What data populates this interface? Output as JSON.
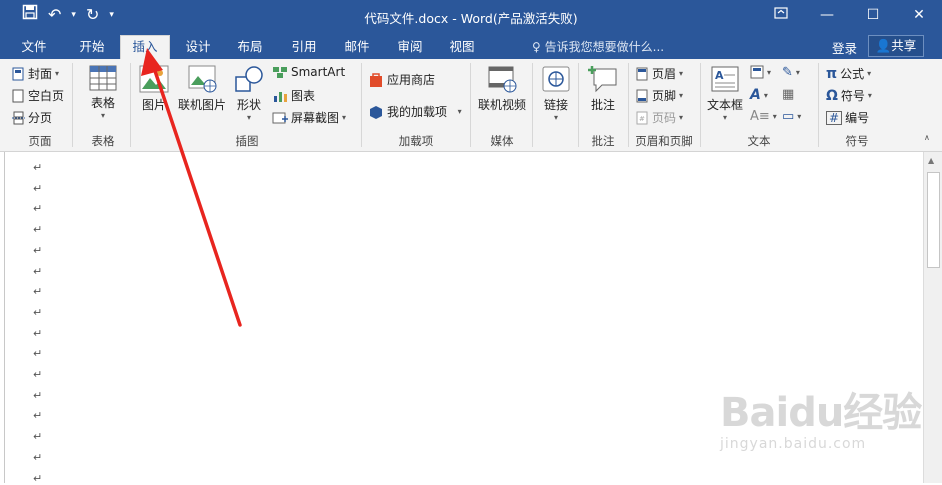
{
  "window": {
    "title": "代码文件.docx - Word(产品激活失败)",
    "controls": [
      "restore-ribbon",
      "minimize",
      "maximize",
      "close"
    ]
  },
  "qat": {
    "save": "save-icon",
    "undo": "undo-icon",
    "redo": "redo-icon"
  },
  "tabs": [
    "文件",
    "开始",
    "插入",
    "设计",
    "布局",
    "引用",
    "邮件",
    "审阅",
    "视图"
  ],
  "active_tab": "插入",
  "tell_me": "告诉我您想要做什么...",
  "login": "登录",
  "share": "共享",
  "ribbon": {
    "pages": {
      "cover": "封面",
      "blank": "空白页",
      "break": "分页",
      "label": "页面"
    },
    "tables": {
      "table": "表格",
      "label": "表格"
    },
    "illustrations": {
      "picture": "图片",
      "online_picture": "联机图片",
      "shapes": "形状",
      "smartart": "SmartArt",
      "chart": "图表",
      "screenshot": "屏幕截图",
      "label": "插图"
    },
    "addins": {
      "store": "应用商店",
      "my_addins": "我的加载项",
      "label": "加载项"
    },
    "media": {
      "online_video": "联机视频",
      "label": "媒体"
    },
    "links": {
      "link": "链接"
    },
    "comments": {
      "comment": "批注",
      "label": "批注"
    },
    "header_footer": {
      "header": "页眉",
      "footer": "页脚",
      "page_number": "页码",
      "label": "页眉和页脚"
    },
    "text": {
      "textbox": "文本框",
      "label": "文本"
    },
    "symbols": {
      "equation": "公式",
      "symbol": "符号",
      "number": "编号",
      "label": "符号"
    }
  },
  "document": {
    "paragraph_mark": "↵",
    "line_count": 16
  },
  "watermark": {
    "main": "Baidu经验",
    "sub": "jingyan.baidu.com"
  },
  "colors": {
    "title_blue": "#2b579a",
    "arrow_red": "#e8251f"
  }
}
